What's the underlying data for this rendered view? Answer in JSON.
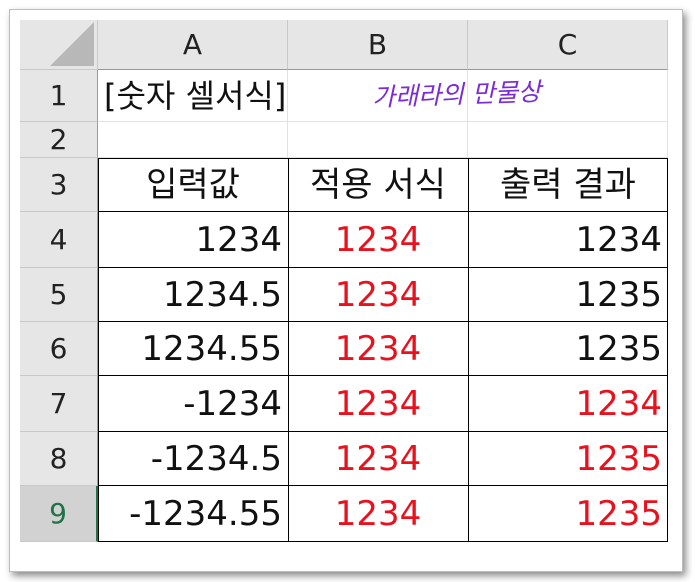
{
  "columns": [
    "A",
    "B",
    "C"
  ],
  "rows": [
    "1",
    "2",
    "3",
    "4",
    "5",
    "6",
    "7",
    "8",
    "9"
  ],
  "active_row": "9",
  "title": "[숫자 셀서식]",
  "handwritten_note": "가래라의 만물상",
  "table": {
    "headers": [
      "입력값",
      "적용 서식",
      "출력 결과"
    ],
    "rows": [
      {
        "input": "1234",
        "format": "1234",
        "output": "1234",
        "output_red": false
      },
      {
        "input": "1234.5",
        "format": "1234",
        "output": "1235",
        "output_red": false
      },
      {
        "input": "1234.55",
        "format": "1234",
        "output": "1235",
        "output_red": false
      },
      {
        "input": "-1234",
        "format": "1234",
        "output": "1234",
        "output_red": true
      },
      {
        "input": "-1234.5",
        "format": "1234",
        "output": "1235",
        "output_red": true
      },
      {
        "input": "-1234.55",
        "format": "1234",
        "output": "1235",
        "output_red": true
      }
    ]
  },
  "colors": {
    "red_text": "#e8121e",
    "active_row_header": "#217346",
    "header_bg": "#e6e6e6",
    "handwriting": "#7a2bd6"
  }
}
